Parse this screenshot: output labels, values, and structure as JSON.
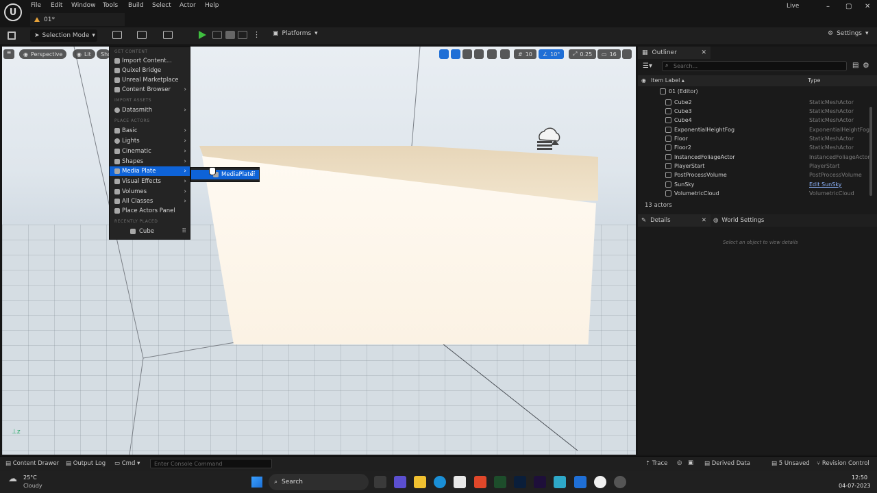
{
  "menubar": {
    "items": [
      "File",
      "Edit",
      "Window",
      "Tools",
      "Build",
      "Select",
      "Actor",
      "Help"
    ],
    "level_tab": "01*",
    "live": "Live"
  },
  "toolbar": {
    "selection_mode": "Selection Mode",
    "platforms": "Platforms",
    "settings": "Settings"
  },
  "viewport": {
    "perspective": "Perspective",
    "lit": "Lit",
    "show": "Sho",
    "grid_snap": "10",
    "rot_snap": "10°",
    "scale_snap": "0.25",
    "cam_speed": "16"
  },
  "place_menu": {
    "sec_get_content": "GET CONTENT",
    "import_content": "Import Content...",
    "quixel_bridge": "Quixel Bridge",
    "unreal_marketplace": "Unreal Marketplace",
    "content_browser": "Content Browser",
    "sec_import_assets": "IMPORT ASSETS",
    "datasmith": "Datasmith",
    "sec_place_actors": "PLACE ACTORS",
    "basic": "Basic",
    "lights": "Lights",
    "cinematic": "Cinematic",
    "shapes": "Shapes",
    "media_plate": "Media Plate",
    "visual_effects": "Visual Effects",
    "volumes": "Volumes",
    "all_classes": "All Classes",
    "place_actors_panel": "Place Actors Panel",
    "sec_recently_placed": "RECENTLY PLACED",
    "cube": "Cube",
    "submenu_item": "MediaPlate"
  },
  "outliner": {
    "tab": "Outliner",
    "search_placeholder": "Search...",
    "col_label": "Item Label ▴",
    "col_type": "Type",
    "root": "01 (Editor)",
    "rows": [
      {
        "name": "Cube2",
        "type": "StaticMeshActor"
      },
      {
        "name": "Cube3",
        "type": "StaticMeshActor"
      },
      {
        "name": "Cube4",
        "type": "StaticMeshActor"
      },
      {
        "name": "ExponentialHeightFog",
        "type": "ExponentialHeightFog"
      },
      {
        "name": "Floor",
        "type": "StaticMeshActor"
      },
      {
        "name": "Floor2",
        "type": "StaticMeshActor"
      },
      {
        "name": "InstancedFoliageActor",
        "type": "InstancedFoliageActor"
      },
      {
        "name": "PlayerStart",
        "type": "PlayerStart"
      },
      {
        "name": "PostProcessVolume",
        "type": "PostProcessVolume"
      },
      {
        "name": "SunSky",
        "type": "Edit SunSky"
      },
      {
        "name": "VolumetricCloud",
        "type": "VolumetricCloud"
      }
    ],
    "count": "13 actors"
  },
  "details": {
    "tab": "Details",
    "world_settings": "World Settings",
    "hint": "Select an object to view details"
  },
  "statusbar": {
    "content_drawer": "Content Drawer",
    "output_log": "Output Log",
    "cmd": "Cmd",
    "console_placeholder": "Enter Console Command",
    "trace": "Trace",
    "derived_data": "Derived Data",
    "unsaved": "5 Unsaved",
    "revision_control": "Revision Control"
  },
  "taskbar": {
    "temp": "25°C",
    "weather": "Cloudy",
    "search": "Search",
    "time": "12:50",
    "date": "04-07-2023"
  },
  "colors": {
    "accent": "#0e63d8",
    "play": "#3fbf3f",
    "panel": "#1a1a1a"
  }
}
